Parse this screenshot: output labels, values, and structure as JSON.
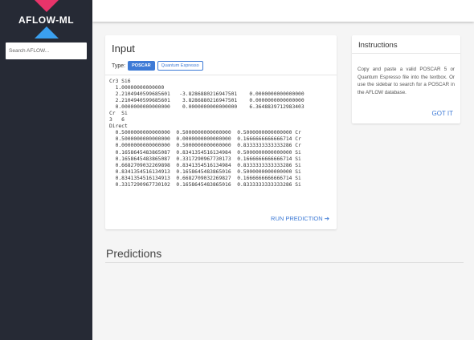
{
  "sidebar": {
    "logo_text": "AFLOW-ML",
    "search_placeholder": "Search AFLOW..."
  },
  "colors": {
    "sidebar_bg": "#262a35",
    "accent": "#3d7ad6",
    "logo_pink": "#e8346a",
    "logo_blue": "#3aa0f0"
  },
  "input_card": {
    "title": "Input",
    "type_label": "Type:",
    "type_options": [
      "POSCAR",
      "Quantum Espresso"
    ],
    "selected_type": "POSCAR",
    "poscar_text": "Cr3 Si6\n  1.00000000000000\n  2.2104940599685601   -3.8286880216947501    0.0000000000000000\n  2.2104940599685601    3.8286880216947501    0.0000000000000000\n  0.0000000000000000    0.0000000000000000    6.3648839712983403\nCr  Si\n3   6\nDirect\n  0.5000000000000000  0.5000000000000000  0.5000000000000000 Cr\n  0.5000000000000000  0.0000000000000000  0.1666666666666714 Cr\n  0.0000000000000000  0.5000000000000000  0.8333333333333286 Cr\n  0.1658645483865087  0.8341354516134984  0.5000000000000000 Si\n  0.1658645483865087  0.3317290967730173  0.1666666666666714 Si\n  0.6682709032269898  0.8341354516134984  0.8333333333333286 Si\n  0.8341354516134913  0.1658645483865016  0.5000000000000000 Si\n  0.8341354516134913  0.6682709032269827  0.1666666666666714 Si\n  0.3317290967730102  0.1658645483865016  0.8333333333333286 Si",
    "run_label": "RUN PREDICTION ➔"
  },
  "instructions": {
    "title": "Instructions",
    "text": "Copy and paste a valid POSCAR 5 or Quantum Espresso file into the textbox. Or use the sidebar to search for a POSCAR in the AFLOW database.",
    "got_it": "GOT IT"
  },
  "predictions": {
    "title": "Predictions"
  }
}
